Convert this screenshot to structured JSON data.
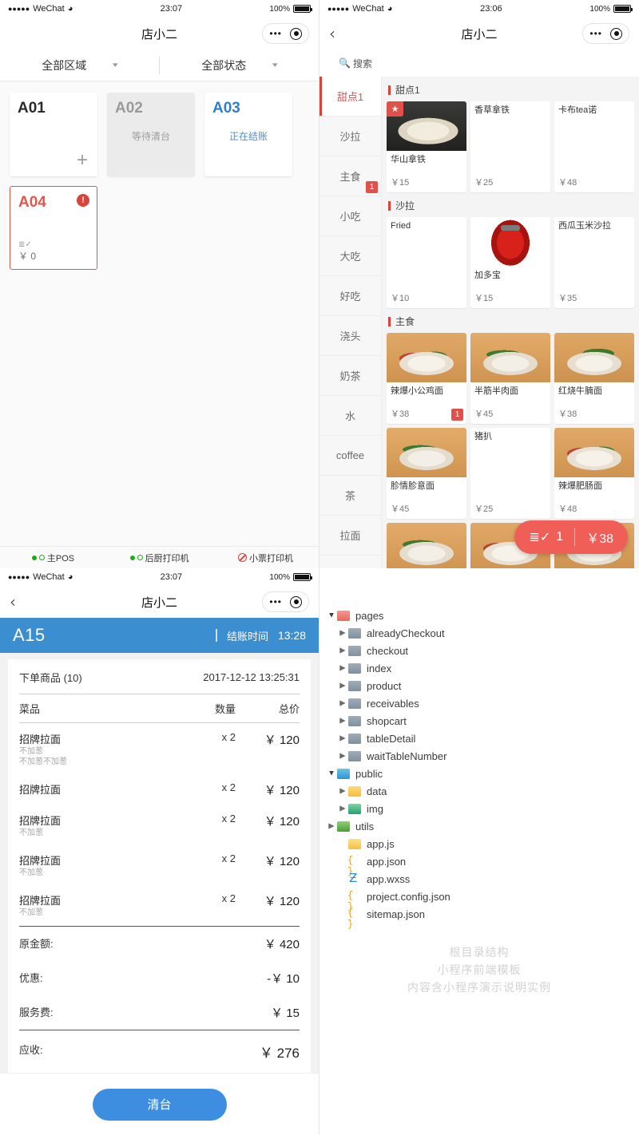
{
  "phone": {
    "carrier": "WeChat",
    "signal_dots": "●●●●●",
    "wifi_icon": "wifi-icon",
    "battery_label": "100%",
    "title": "店小二",
    "capsule_more": "•••",
    "back_icon": "‹"
  },
  "panel_tables": {
    "time": "23:07",
    "filters": [
      {
        "label": "全部区域",
        "icon": "chevron-down-icon"
      },
      {
        "label": "全部状态",
        "icon": "chevron-down-icon"
      }
    ],
    "tables": [
      {
        "name": "A01",
        "state": "",
        "status": "free",
        "action_icon": "plus-icon"
      },
      {
        "name": "A02",
        "state": "等待清台",
        "status": "waiting"
      },
      {
        "name": "A03",
        "state": "正在结账",
        "status": "billing"
      },
      {
        "name": "A04",
        "state": "",
        "status": "alert",
        "alert_icon": "!",
        "amount": "￥ 0",
        "note_icon": "order-lines-icon"
      }
    ],
    "printers": [
      {
        "label": "主POS",
        "status": "online"
      },
      {
        "label": "后厨打印机",
        "status": "online"
      },
      {
        "label": "小票打印机",
        "status": "offline"
      }
    ]
  },
  "panel_order": {
    "time": "23:07",
    "table": "A15",
    "checkout_label": "结账时间",
    "checkout_time": "13:28",
    "items_header": "下单商品 (10)",
    "order_datetime": "2017-12-12 13:25:31",
    "columns": {
      "name": "菜品",
      "qty": "数量",
      "total": "总价"
    },
    "items": [
      {
        "name": "招牌拉面",
        "notes": [
          "不加葱",
          "不加葱不加葱"
        ],
        "qty": "x 2",
        "total": "￥ 120"
      },
      {
        "name": "招牌拉面",
        "notes": [],
        "qty": "x 2",
        "total": "￥ 120"
      },
      {
        "name": "招牌拉面",
        "notes": [
          "不加葱"
        ],
        "qty": "x 2",
        "total": "￥ 120"
      },
      {
        "name": "招牌拉面",
        "notes": [
          "不加葱"
        ],
        "qty": "x 2",
        "total": "￥ 120"
      },
      {
        "name": "招牌拉面",
        "notes": [
          "不加葱"
        ],
        "qty": "x 2",
        "total": "￥ 120"
      }
    ],
    "summary": [
      {
        "label": "原金额:",
        "value": "￥ 420"
      },
      {
        "label": "优惠:",
        "value": "-￥ 10"
      },
      {
        "label": "服务费:",
        "value": "￥ 15"
      }
    ],
    "total": {
      "label": "应收:",
      "value": "￥ 276"
    },
    "clear_button": "清台"
  },
  "panel_menu": {
    "time": "23:06",
    "search": {
      "label": "搜索",
      "icon": "search-icon"
    },
    "categories": [
      {
        "label": "甜点1",
        "active": true,
        "badge": ""
      },
      {
        "label": "沙拉",
        "active": false,
        "badge": ""
      },
      {
        "label": "主食",
        "active": false,
        "badge": "1"
      },
      {
        "label": "小吃",
        "active": false,
        "badge": ""
      },
      {
        "label": "大吃",
        "active": false,
        "badge": ""
      },
      {
        "label": "好吃",
        "active": false,
        "badge": ""
      },
      {
        "label": "浇头",
        "active": false,
        "badge": ""
      },
      {
        "label": "奶茶",
        "active": false,
        "badge": ""
      },
      {
        "label": "水",
        "active": false,
        "badge": ""
      },
      {
        "label": "coffee",
        "active": false,
        "badge": ""
      },
      {
        "label": "茶",
        "active": false,
        "badge": ""
      },
      {
        "label": "拉面",
        "active": false,
        "badge": ""
      }
    ],
    "sections": [
      {
        "title": "甜点1",
        "items": [
          {
            "name": "华山拿铁",
            "price": "￥15",
            "photo": "noodle-dark",
            "star": true,
            "badge": ""
          },
          {
            "name": "香草拿铁",
            "price": "￥25",
            "photo": "none",
            "star": false,
            "badge": ""
          },
          {
            "name": "卡布tea诺",
            "price": "￥48",
            "photo": "none",
            "star": false,
            "badge": ""
          }
        ]
      },
      {
        "title": "沙拉",
        "items": [
          {
            "name": "Fried",
            "price": "￥10",
            "photo": "none",
            "star": false,
            "badge": ""
          },
          {
            "name": "加多宝",
            "price": "￥15",
            "photo": "can",
            "star": false,
            "badge": ""
          },
          {
            "name": "西瓜玉米沙拉",
            "price": "￥35",
            "photo": "none",
            "star": false,
            "badge": ""
          }
        ]
      },
      {
        "title": "主食",
        "items": [
          {
            "name": "辣爆小公鸡面",
            "price": "￥38",
            "photo": "noodle1",
            "star": false,
            "badge": "1"
          },
          {
            "name": "半筋半肉面",
            "price": "￥45",
            "photo": "noodle2",
            "star": false,
            "badge": ""
          },
          {
            "name": "红烧牛腩面",
            "price": "￥38",
            "photo": "noodle3",
            "star": false,
            "badge": ""
          },
          {
            "name": "胗情胗意面",
            "price": "￥45",
            "photo": "noodle2",
            "star": false,
            "badge": ""
          },
          {
            "name": "猪扒",
            "price": "￥25",
            "photo": "none",
            "star": false,
            "badge": ""
          },
          {
            "name": "辣爆肥肠面",
            "price": "￥48",
            "photo": "noodle1",
            "star": false,
            "badge": ""
          },
          {
            "name": "",
            "price": "",
            "photo": "noodle2",
            "star": false,
            "badge": ""
          },
          {
            "name": "",
            "price": "",
            "photo": "noodle1",
            "star": false,
            "badge": ""
          },
          {
            "name": "",
            "price": "",
            "photo": "noodle3",
            "star": false,
            "badge": ""
          }
        ]
      }
    ],
    "cart": {
      "count": "1",
      "amount": "￥38",
      "icon": "cart-lines-icon"
    }
  },
  "panel_tree": {
    "nodes": [
      {
        "label": "pages",
        "indent": 0,
        "twist": "open",
        "icon": "folder-red"
      },
      {
        "label": "alreadyCheckout",
        "indent": 1,
        "twist": "closed",
        "icon": "folder-gray"
      },
      {
        "label": "checkout",
        "indent": 1,
        "twist": "closed",
        "icon": "folder-gray"
      },
      {
        "label": "index",
        "indent": 1,
        "twist": "closed",
        "icon": "folder-gray"
      },
      {
        "label": "product",
        "indent": 1,
        "twist": "closed",
        "icon": "folder-gray"
      },
      {
        "label": "receivables",
        "indent": 1,
        "twist": "closed",
        "icon": "folder-gray"
      },
      {
        "label": "shopcart",
        "indent": 1,
        "twist": "closed",
        "icon": "folder-gray"
      },
      {
        "label": "tableDetail",
        "indent": 1,
        "twist": "closed",
        "icon": "folder-gray"
      },
      {
        "label": "waitTableNumber",
        "indent": 1,
        "twist": "closed",
        "icon": "folder-gray"
      },
      {
        "label": "public",
        "indent": 0,
        "twist": "open",
        "icon": "folder-blue"
      },
      {
        "label": "data",
        "indent": 1,
        "twist": "closed",
        "icon": "folder-yellow"
      },
      {
        "label": "img",
        "indent": 1,
        "twist": "closed",
        "icon": "folder-teal"
      },
      {
        "label": "utils",
        "indent": 0,
        "twist": "closed",
        "icon": "folder-green"
      },
      {
        "label": "app.js",
        "indent": 1,
        "twist": "none",
        "icon": "js"
      },
      {
        "label": "app.json",
        "indent": 1,
        "twist": "none",
        "icon": "json"
      },
      {
        "label": "app.wxss",
        "indent": 1,
        "twist": "none",
        "icon": "wxss"
      },
      {
        "label": "project.config.json",
        "indent": 1,
        "twist": "none",
        "icon": "json"
      },
      {
        "label": "sitemap.json",
        "indent": 1,
        "twist": "none",
        "icon": "json"
      }
    ],
    "watermark": [
      "根目录结构",
      "小程序前端模板",
      "内容含小程序演示说明实例"
    ]
  },
  "colors": {
    "accent_blue": "#3b8ed0",
    "accent_red": "#e2504a",
    "cart_red": "#ef5f58",
    "online_green": "#1aad19"
  }
}
